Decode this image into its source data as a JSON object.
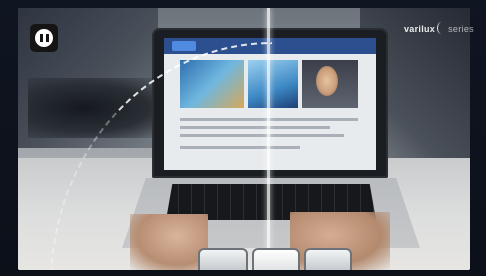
{
  "player": {
    "pause_icon": "pause-icon",
    "brand_main": "varilux",
    "brand_sub": "series"
  }
}
